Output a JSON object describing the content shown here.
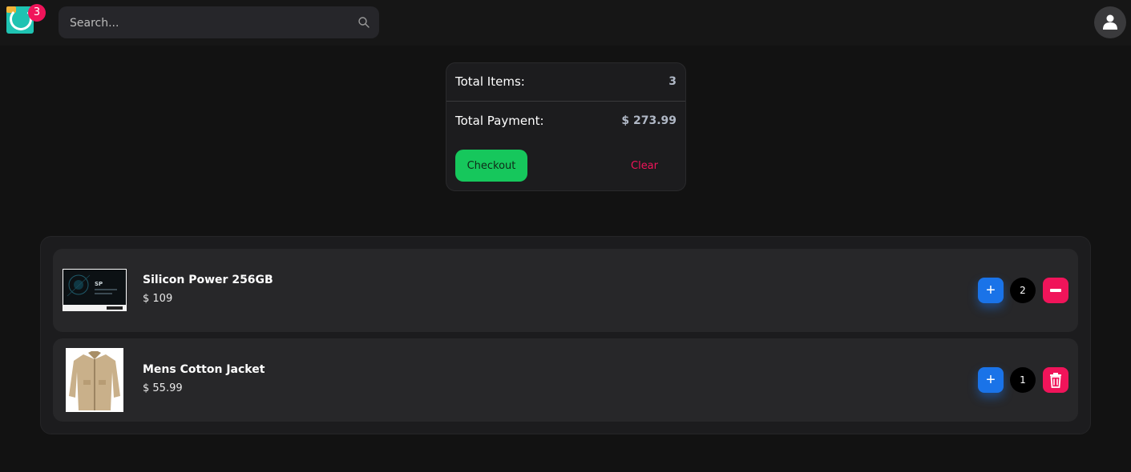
{
  "header": {
    "cart_badge_count": "3",
    "search": {
      "placeholder": "Search..."
    }
  },
  "summary": {
    "total_items_label": "Total Items:",
    "total_items_value": "3",
    "total_payment_label": "Total Payment:",
    "total_payment_value": "$ 273.99",
    "checkout_label": "Checkout",
    "clear_label": "Clear"
  },
  "cart": {
    "items": [
      {
        "name": "Silicon Power 256GB",
        "price": "$ 109",
        "quantity": "2",
        "decrease_icon": "minus-icon"
      },
      {
        "name": "Mens Cotton Jacket",
        "price": "$ 55.99",
        "quantity": "1",
        "decrease_icon": "trash-icon"
      }
    ],
    "increase_label": "+"
  },
  "colors": {
    "accent_blue": "#1a73e8",
    "danger_pink": "#f0145a",
    "checkout_green": "#16c75c",
    "logo_teal": "#1fc3b2"
  }
}
